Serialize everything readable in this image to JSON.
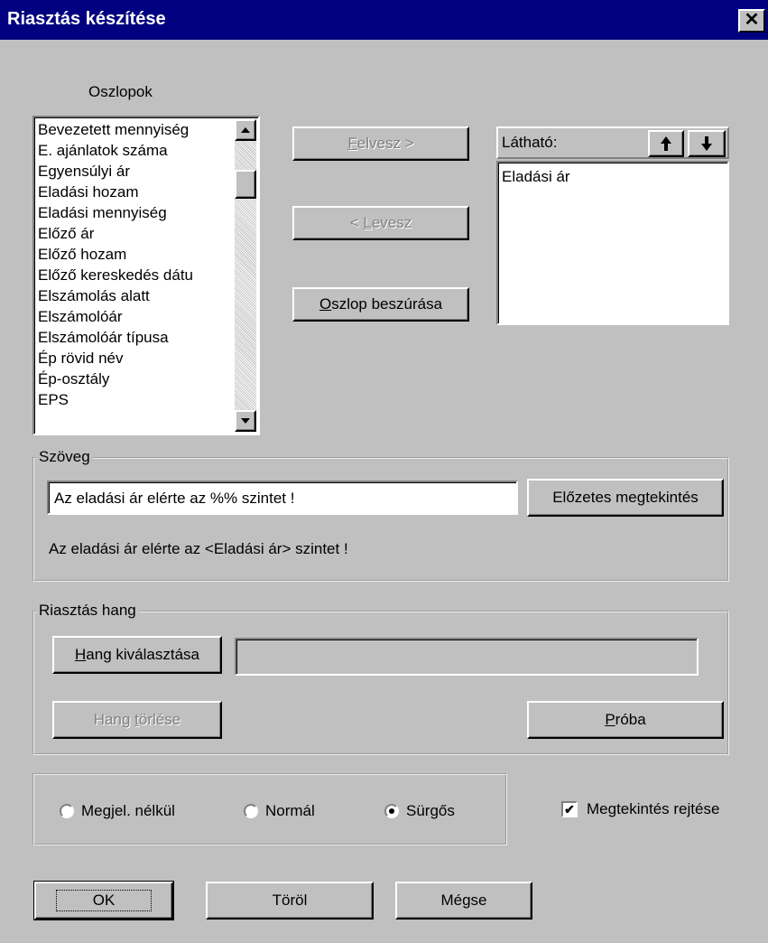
{
  "window": {
    "title": "Riasztás készítése",
    "close_glyph": "✕"
  },
  "columns": {
    "heading": "Oszlopok",
    "items": [
      "Bevezetett mennyiség",
      "E. ajánlatok száma",
      "Egyensúlyi ár",
      "Eladási hozam",
      "Eladási mennyiség",
      "Előző ár",
      "Előző hozam",
      "Előző kereskedés dátu",
      "Elszámolás alatt",
      "Elszámolóár",
      "Elszámolóár típusa",
      "Ép rövid név",
      "Ép-osztály",
      "EPS"
    ]
  },
  "middle": {
    "add_label_u": "F",
    "add_label_rest": "elvesz >",
    "remove_label_pre": "< ",
    "remove_label_u": "L",
    "remove_label_rest": "evesz",
    "insert_label_u": "O",
    "insert_label_rest": "szlop beszúrása"
  },
  "visible": {
    "label": "Látható:",
    "up_icon": "arrow-up",
    "down_icon": "arrow-down",
    "items": [
      "Eladási ár"
    ]
  },
  "text_group": {
    "legend": "Szöveg",
    "input_value": "Az eladási ár elérte az %% szintet !",
    "preview_button": "Előzetes megtekintés",
    "preview_text": "Az eladási ár elérte az <Eladási ár> szintet !"
  },
  "sound_group": {
    "legend": "Riasztás hang",
    "select_u": "H",
    "select_rest": "ang kiválasztása",
    "sound_path": "",
    "delete_pre": "Hang ",
    "delete_u": "t",
    "delete_rest": "örlése",
    "test_u": "P",
    "test_rest": "róba"
  },
  "priority": {
    "options": [
      "Megjel. nélkül",
      "Normál",
      "Sürgős"
    ],
    "selected": "Sürgős"
  },
  "hide_preview": {
    "label": "Megtekintés rejtése",
    "checked": true
  },
  "footer": {
    "ok": "OK",
    "delete": "Töröl",
    "cancel": "Mégse"
  }
}
